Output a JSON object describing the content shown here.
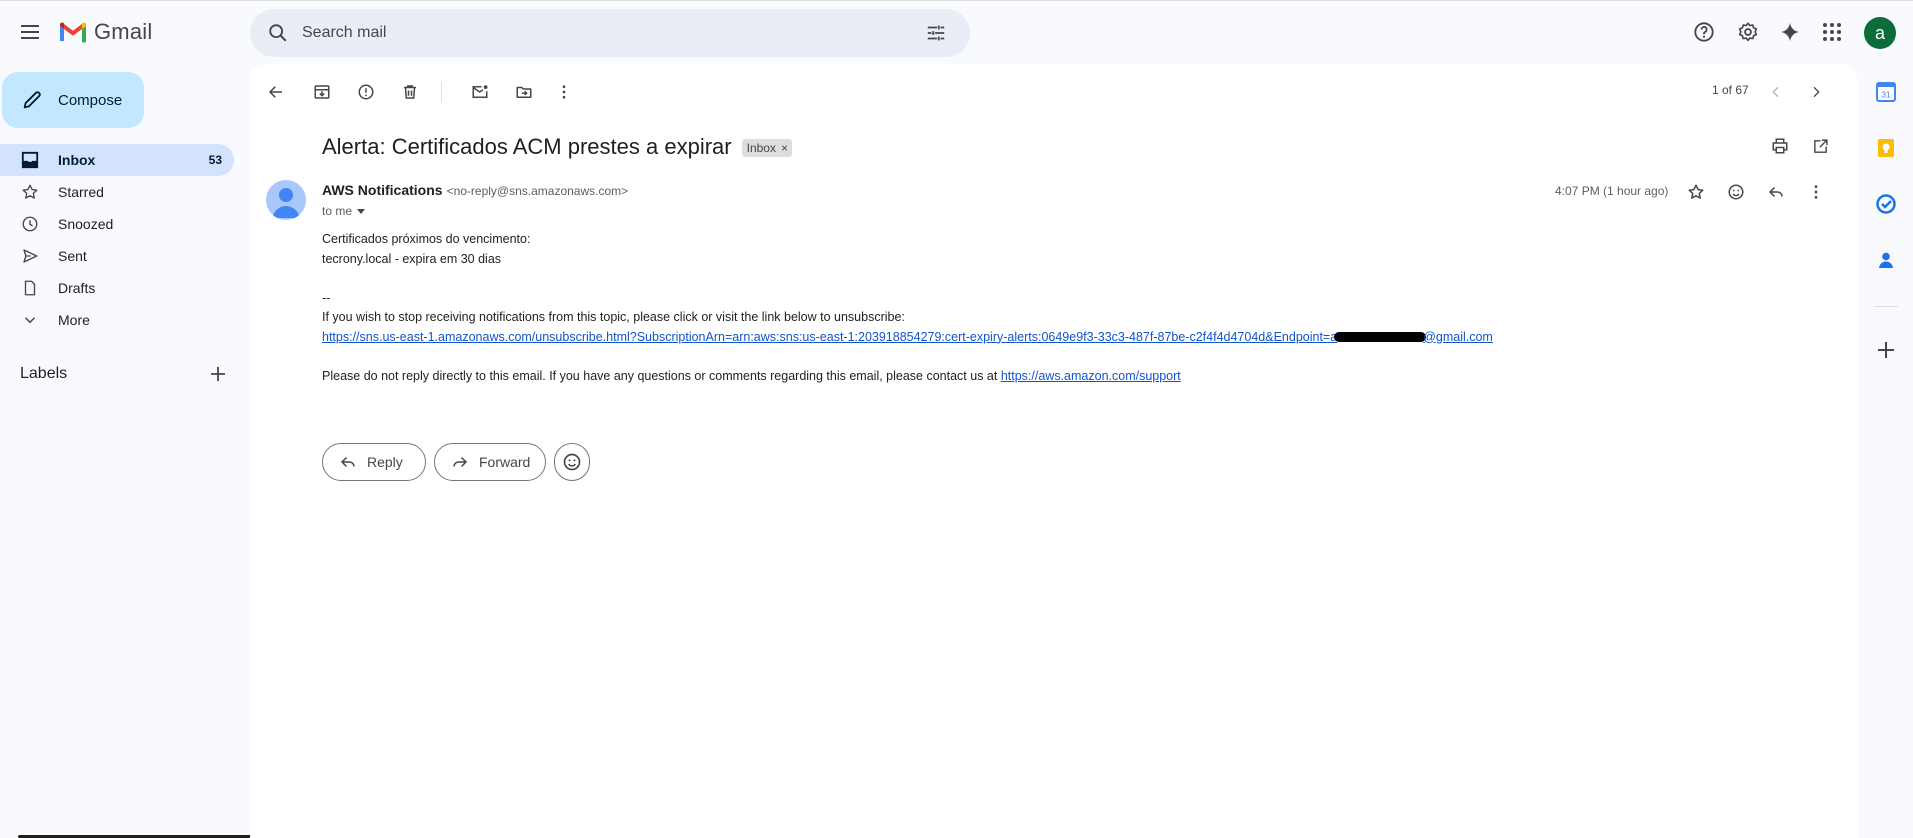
{
  "app": {
    "name": "Gmail"
  },
  "search": {
    "placeholder": "Search mail"
  },
  "compose": {
    "label": "Compose"
  },
  "nav": {
    "items": [
      {
        "label": "Inbox",
        "count": "53",
        "icon": "inbox-icon"
      },
      {
        "label": "Starred",
        "count": "",
        "icon": "star-icon"
      },
      {
        "label": "Snoozed",
        "count": "",
        "icon": "clock-icon"
      },
      {
        "label": "Sent",
        "count": "",
        "icon": "send-icon"
      },
      {
        "label": "Drafts",
        "count": "",
        "icon": "draft-icon"
      },
      {
        "label": "More",
        "count": "",
        "icon": "chevron-down-icon"
      }
    ],
    "labels_title": "Labels"
  },
  "toolbar": {
    "pager": "1 of 67"
  },
  "message": {
    "subject": "Alerta: Certificados ACM prestes a expirar",
    "label_chip": "Inbox",
    "chip_close": "×",
    "sender_name": "AWS Notifications",
    "sender_email": "<no-reply@sns.amazonaws.com>",
    "to": "to me",
    "date": "4:07 PM (1 hour ago)",
    "body": {
      "line1": "Certificados próximos do vencimento:",
      "line2": "tecrony.local - expira em 30 dias",
      "sig": "--",
      "unsub_text": "If you wish to stop receiving notifications from this topic, please click or visit the link below to unsubscribe:",
      "unsub_link_start": "https://sns.us-east-1.amazonaws.com/unsubscribe.html?SubscriptionArn=arn:aws:sns:us-east-1:203918854279:cert-expiry-alerts:0649e9f3-33c3-487f-87be-c2f4f4d4704d&Endpoint=a",
      "unsub_link_end": "@gmail.com",
      "noreply_text": "Please do not reply directly to this email. If you have any questions or comments regarding this email, please contact us at ",
      "support_link": "https://aws.amazon.com/support"
    }
  },
  "actions": {
    "reply": "Reply",
    "forward": "Forward"
  },
  "colors": {
    "accent": "#0b57d0",
    "compose_bg": "#c2e7ff",
    "active_nav_bg": "#d3e3fd",
    "link": "#1155cc",
    "avatar_bg": "#0b6e3a"
  },
  "user": {
    "avatar_letter": "a"
  },
  "rail": {
    "calendar_day": "31"
  }
}
